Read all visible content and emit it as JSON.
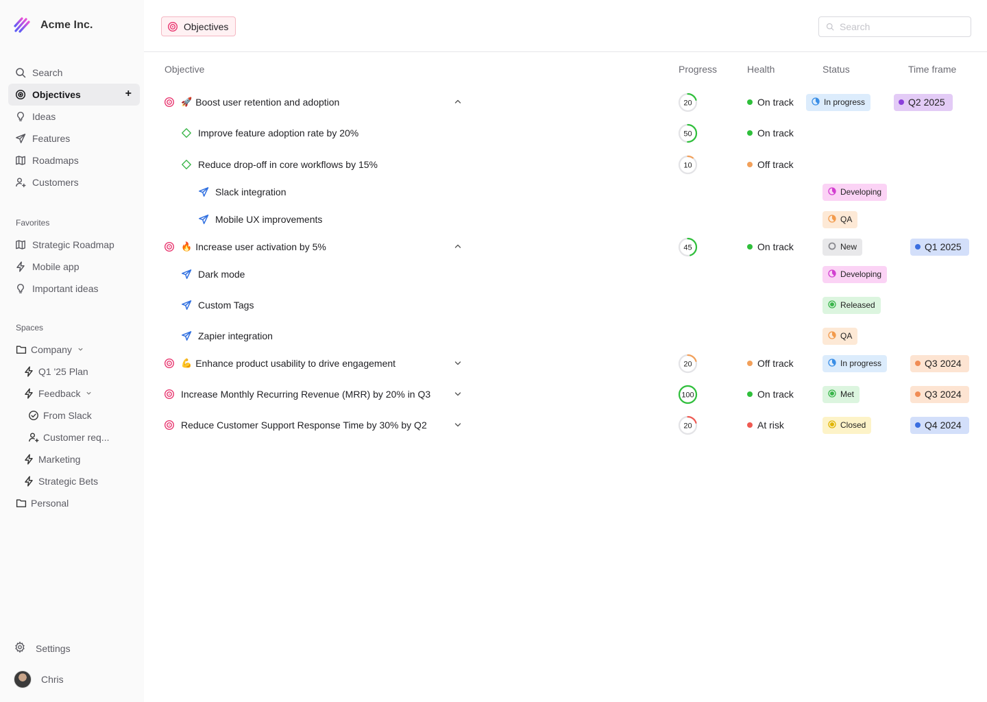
{
  "brand": {
    "name": "Acme Inc."
  },
  "nav": [
    {
      "label": "Search",
      "icon": "search-icon",
      "active": false
    },
    {
      "label": "Objectives",
      "icon": "target-icon",
      "active": true
    },
    {
      "label": "Ideas",
      "icon": "lightbulb-icon",
      "active": false
    },
    {
      "label": "Features",
      "icon": "paper-plane-icon",
      "active": false
    },
    {
      "label": "Roadmaps",
      "icon": "map-icon",
      "active": false
    },
    {
      "label": "Customers",
      "icon": "user-icon",
      "active": false
    }
  ],
  "favorites": {
    "heading": "Favorites",
    "items": [
      {
        "label": "Strategic Roadmap",
        "icon": "map-icon"
      },
      {
        "label": "Mobile app",
        "icon": "lightning-icon"
      },
      {
        "label": "Important ideas",
        "icon": "lightbulb-icon"
      }
    ]
  },
  "spaces": {
    "heading": "Spaces",
    "items": [
      {
        "label": "Company",
        "icon": "folder-icon",
        "level": 0,
        "expandable": true
      },
      {
        "label": "Q1 '25 Plan",
        "icon": "lightning-icon",
        "level": 1,
        "expandable": false
      },
      {
        "label": "Feedback",
        "icon": "lightning-icon",
        "level": 1,
        "expandable": true
      },
      {
        "label": "From Slack",
        "icon": "check-circle-icon",
        "level": 2,
        "expandable": false
      },
      {
        "label": "Customer req...",
        "icon": "user-icon",
        "level": 2,
        "expandable": false
      },
      {
        "label": "Marketing",
        "icon": "lightning-icon",
        "level": 1,
        "expandable": false
      },
      {
        "label": "Strategic Bets",
        "icon": "lightning-icon",
        "level": 1,
        "expandable": false
      },
      {
        "label": "Personal",
        "icon": "folder-icon",
        "level": 0,
        "expandable": false
      }
    ]
  },
  "footer": {
    "settings_label": "Settings",
    "user_name": "Chris"
  },
  "header": {
    "crumb_label": "Objectives",
    "search_placeholder": "Search"
  },
  "table": {
    "columns": [
      "Objective",
      "Progress",
      "Health",
      "Status",
      "Time frame"
    ],
    "rows": [
      {
        "type": "objective",
        "emoji": "🚀",
        "title": "Boost user retention and adoption",
        "expanded": true,
        "progress": 20,
        "health": "On track",
        "status": "In progress",
        "timeframe": "Q2 2025"
      },
      {
        "type": "key-result",
        "title": "Improve feature adoption rate by 20%",
        "progress": 50,
        "health": "On track"
      },
      {
        "type": "key-result",
        "title": "Reduce drop-off in core workflows by 15%",
        "progress": 10,
        "health": "Off track"
      },
      {
        "type": "feature",
        "indent": 2,
        "title": "Slack integration",
        "status": "Developing"
      },
      {
        "type": "feature",
        "indent": 2,
        "title": "Mobile UX improvements",
        "status": "QA"
      },
      {
        "type": "objective",
        "emoji": "🔥",
        "title": "Increase user activation by 5%",
        "expanded": true,
        "progress": 45,
        "health": "On track",
        "status": "New",
        "timeframe": "Q1 2025"
      },
      {
        "type": "feature",
        "indent": 1,
        "title": "Dark mode",
        "status": "Developing"
      },
      {
        "type": "feature",
        "indent": 1,
        "title": "Custom Tags",
        "status": "Released"
      },
      {
        "type": "feature",
        "indent": 1,
        "title": "Zapier integration",
        "status": "QA"
      },
      {
        "type": "objective",
        "emoji": "💪",
        "title": "Enhance product usability to drive engagement",
        "expanded": false,
        "progress": 20,
        "health": "Off track",
        "status": "In progress",
        "timeframe": "Q3 2024"
      },
      {
        "type": "objective",
        "title": "Increase Monthly Recurring Revenue (MRR) by 20% in Q3",
        "expanded": false,
        "progress": 100,
        "health": "On track",
        "status": "Met",
        "timeframe": "Q3 2024"
      },
      {
        "type": "objective",
        "title": "Reduce Customer Support Response Time by 30% by Q2",
        "expanded": false,
        "progress": 20,
        "health": "At risk",
        "status": "Closed",
        "timeframe": "Q4 2024"
      }
    ]
  },
  "colors": {
    "health": {
      "On track": "#2fbf3b",
      "Off track": "#f2a05a",
      "At risk": "#ef5a52"
    },
    "status": {
      "In progress": {
        "bg": "#dcecfc",
        "icon": "#3a8ee6"
      },
      "Developing": {
        "bg": "#fbd3f5",
        "icon": "#d23ed0"
      },
      "QA": {
        "bg": "#fde9d6",
        "icon": "#f29a4b"
      },
      "New": {
        "bg": "#e8e8ea",
        "icon": "#8a8a90"
      },
      "Released": {
        "bg": "#dcf5df",
        "icon": "#39b54a"
      },
      "Met": {
        "bg": "#dcf5df",
        "icon": "#39b54a"
      },
      "Closed": {
        "bg": "#fdf3c8",
        "icon": "#e0b400"
      }
    },
    "timeframe": {
      "Q2 2025": {
        "bg": "#e3cbf6",
        "dot": "#8b3fdb"
      },
      "Q1 2025": {
        "bg": "#d3dffa",
        "dot": "#3a6ee0"
      },
      "Q3 2024": {
        "bg": "#fde4d2",
        "dot": "#f08c55"
      },
      "Q4 2024": {
        "bg": "#d3dffa",
        "dot": "#3a6ee0"
      }
    },
    "accent": "#e8366f"
  }
}
